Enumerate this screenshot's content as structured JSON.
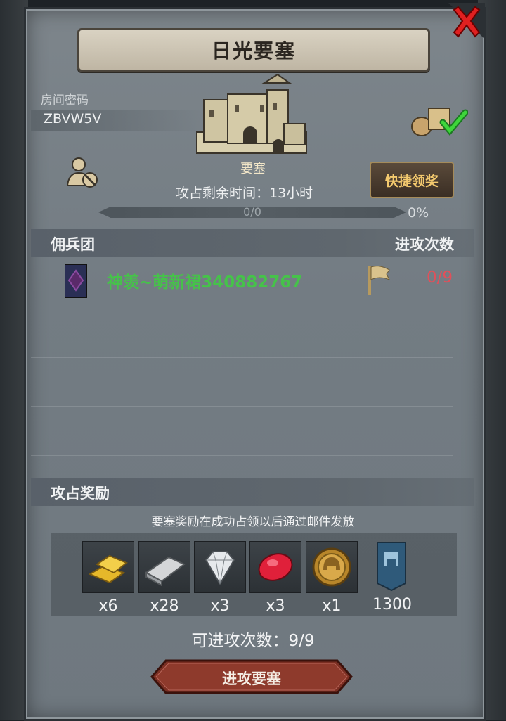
{
  "title": "日光要塞",
  "room": {
    "label": "房间密码",
    "code": "ZBVW5V"
  },
  "fortress": {
    "name": "要塞",
    "time_label": "攻占剩余时间：13小时",
    "progress_text": "0/0",
    "progress_percent": "0%",
    "progress_fraction": 0
  },
  "quick_claim_label": "快捷领奖",
  "mercenary_section": {
    "title": "佣兵团",
    "attack_header": "进攻次数"
  },
  "members": [
    {
      "name": "神羡~萌新裙340882767",
      "attacks": "0/9"
    }
  ],
  "rewards_section": {
    "title": "攻占奖励",
    "note": "要塞奖励在成功占领以后通过邮件发放",
    "items": [
      {
        "icon": "gold-bar-icon",
        "qty": "x6"
      },
      {
        "icon": "silver-bar-icon",
        "qty": "x28"
      },
      {
        "icon": "diamond-icon",
        "qty": "x3"
      },
      {
        "icon": "ruby-icon",
        "qty": "x3"
      },
      {
        "icon": "helmet-medal-icon",
        "qty": "x1"
      },
      {
        "icon": "fortress-banner-icon",
        "qty": "1300"
      }
    ]
  },
  "attempts_label": "可进攻次数：9/9",
  "attack_button_label": "进攻要塞",
  "colors": {
    "member_name": "#46c24a",
    "attack_count": "#e0505a",
    "quick_button_text": "#f3c96e"
  }
}
